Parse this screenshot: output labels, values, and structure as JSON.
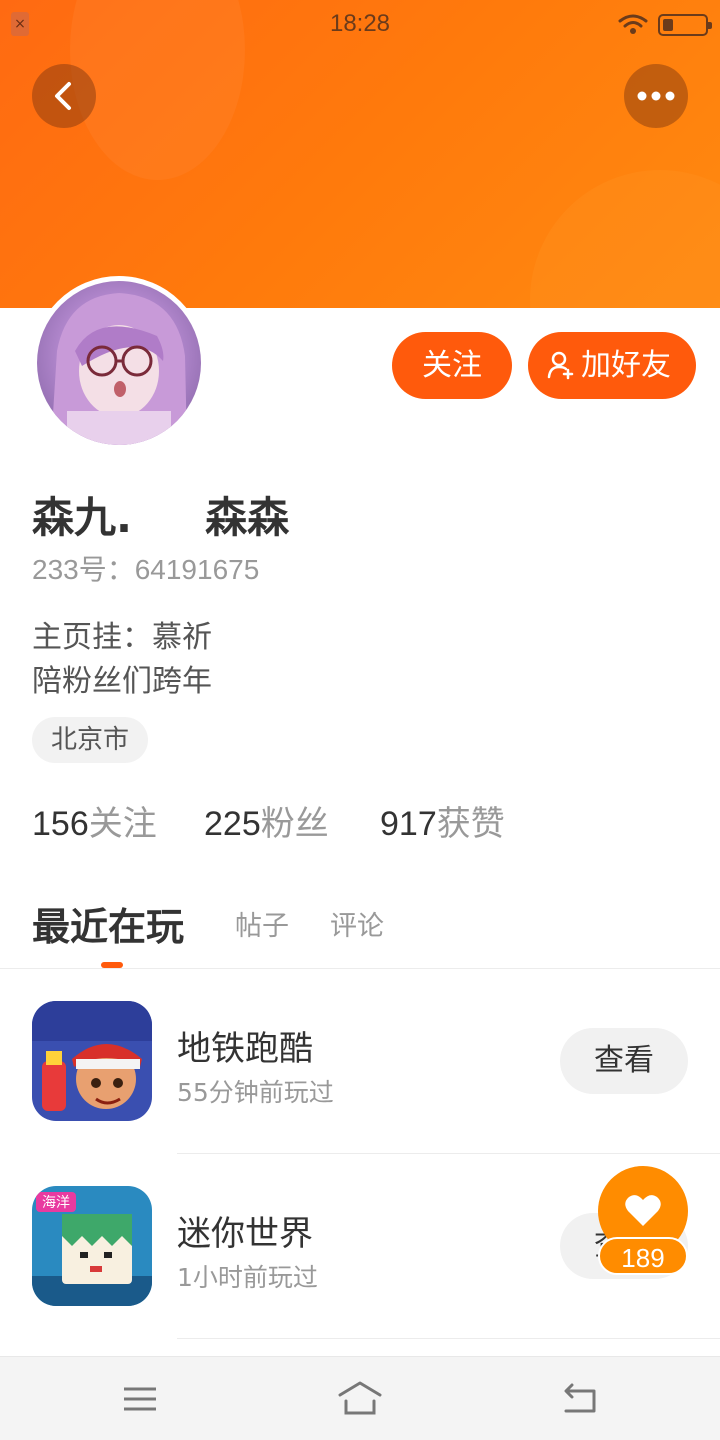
{
  "status_bar": {
    "time": "18:28"
  },
  "header": {
    "back_icon": "chevron-left-icon",
    "more_icon": "more-dots-icon"
  },
  "profile": {
    "follow_label": "关注",
    "add_friend_label": "加好友",
    "name": "森九.     森森",
    "id_text": "233号：64191675",
    "bio_line1": "主页挂：慕祈",
    "bio_line2": "陪粉丝们跨年",
    "location": "北京市"
  },
  "stats": {
    "following": {
      "count": "156",
      "label": "关注"
    },
    "fans": {
      "count": "225",
      "label": "粉丝"
    },
    "likes": {
      "count": "917",
      "label": "获赞"
    }
  },
  "tabs": [
    {
      "label": "最近在玩"
    },
    {
      "label": "帖子"
    },
    {
      "label": "评论"
    }
  ],
  "games": [
    {
      "name": "地铁跑酷",
      "time": "55分钟前玩过",
      "button": "查看"
    },
    {
      "name": "迷你世界",
      "time": "1小时前玩过",
      "button": "查看"
    }
  ],
  "like_fab": {
    "count": "189"
  },
  "colors": {
    "accent": "#ff5a0c",
    "header_gradient_start": "#ff6a12",
    "fab": "#ff8c00"
  }
}
